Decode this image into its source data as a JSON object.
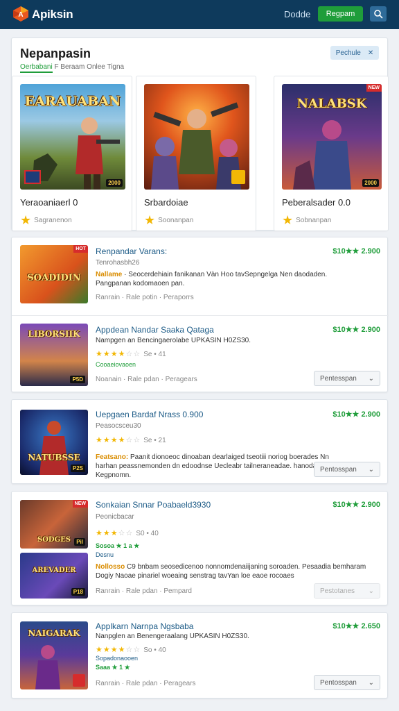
{
  "header": {
    "brand": "Apiksin",
    "nav_link": "Dodde",
    "nav_button": "Regpam",
    "search_icon": "search-icon"
  },
  "featured": {
    "title": "Nepanpasin",
    "tabs": [
      "Oerbabani",
      "F Beraam Onlee",
      "Tigna"
    ],
    "button": "Pechule",
    "cards": [
      {
        "name": "Yeraoaniaerl 0",
        "rating_text": "Sagranenon",
        "art_text": "EARAUABAN",
        "badge": "2000"
      },
      {
        "name": "Srbardoiae",
        "rating_text": "Soonanpan",
        "art_text": "",
        "badge": ""
      },
      {
        "name": "Peberalsader 0.0",
        "rating_text": "Sobnanpan",
        "art_text": "NALABSK",
        "badge": "2000"
      }
    ]
  },
  "list": [
    {
      "title": "Renpandar Varans:",
      "price": "$10★★ 2.900",
      "sub": "Tenrohasbh26",
      "desc_hl": "Nallame",
      "desc": "· Seocerdehiain fanikanan Vàn Hoo tavSepngelga Nen daodaden. Pangpanan kodomaoen pan.",
      "meta": "Ranrain · Rale potin · Peraporrs",
      "art_text": "SOADIDIN",
      "badge": ""
    },
    {
      "title": "Appdean Nandar Saaka Qataga",
      "price": "$10★★ 2.900",
      "sub": "Nampgen an Bencingaerolabe UPKASIN H0ZS30.",
      "stars_text": "Se • 41",
      "green": "Cooaeiovaoen",
      "meta": "Noanain · Rale pdan · Peragears",
      "select": "Pentesspan",
      "art_text": "LIBORSIIK",
      "badge": "P5D"
    },
    {
      "title": "Uepgaen Bardaf Nrass 0.900",
      "price": "$10★★ 2.900",
      "sub": "Peasocsceu30",
      "stars_text": "Se • 21",
      "desc_hl": "Featsano:",
      "desc": "Paanit dionoeoc dinoaban dearlaiged tseotiii noriog boerades Nn harhan peassnemonden dn edoodnse Uecleabr tailneraneadae. hanodad Kegpnomn.",
      "select": "Pentosspan",
      "art_text": "NATUBSSE",
      "badge": "P2S"
    },
    {
      "title": "Sonkaian Snnar Poabaeld3930",
      "price": "$10★★ 2.900",
      "sub": "Peonicbacar",
      "stars_text": "S0 • 40",
      "green": "Sosoa ★ 1 a ★",
      "green2": "Desnu",
      "desc_hl": "Nollosso",
      "desc": "C9 bnbam seosedicenoo nonnomdenaiijaning soroaden. Pesaadia bemharam Dogiy Naoae pinariel woeaing senstrag tavYan loe eaoe rocoaes",
      "meta": "Ranrain · Rale pdan · Pempard",
      "select": "Pestotanes",
      "art_text": "SODGES",
      "badge": "Pil",
      "art_text2": "AREVADER",
      "badge2": "P18"
    },
    {
      "title": "Applkarn Narnpa Ngsbaba",
      "price": "$10★★ 2.650",
      "sub": "Nanpglen an Benengeraalang UPKASIN H0ZS30.",
      "stars_text": "So • 40",
      "green": "Sopadonaooen",
      "green2": "Saaa ★ 1 ★",
      "meta": "Ranrain · Rale pdan · Peragears",
      "select": "Pentosspan",
      "art_text": "NAIGARAK",
      "badge": ""
    }
  ],
  "colors": {
    "header_bg": "#0e3a5c",
    "accent_green": "#1f9d3a",
    "link_blue": "#1b5a86",
    "star": "#f2b705"
  }
}
